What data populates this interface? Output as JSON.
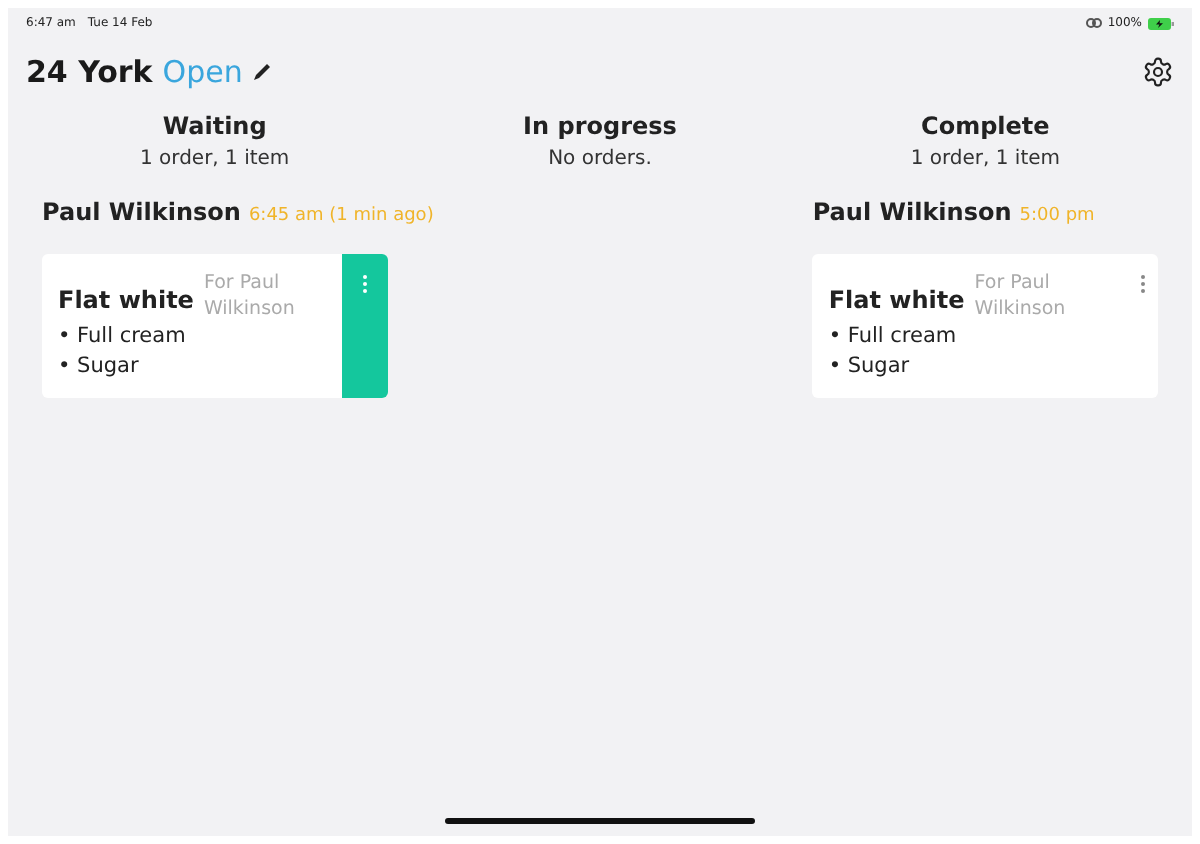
{
  "status_bar": {
    "time": "6:47 am",
    "date": "Tue 14 Feb",
    "battery": "100%"
  },
  "header": {
    "title": "24 York",
    "status": "Open"
  },
  "columns": [
    {
      "title": "Waiting",
      "summary": "1 order,  1 item",
      "orders": [
        {
          "customer": "Paul Wilkinson",
          "time": "6:45 am (1 min ago)",
          "items": [
            {
              "name": "Flat white",
              "for": "For Paul Wilkinson",
              "options": [
                "• Full cream",
                "• Sugar"
              ],
              "highlighted": true
            }
          ]
        }
      ]
    },
    {
      "title": "In progress",
      "summary": "No orders."
    },
    {
      "title": "Complete",
      "summary": "1 order,  1 item",
      "orders": [
        {
          "customer": "Paul Wilkinson",
          "time": "5:00 pm",
          "items": [
            {
              "name": "Flat white",
              "for": "For Paul Wilkinson",
              "options": [
                "• Full cream",
                "• Sugar"
              ],
              "highlighted": false
            }
          ]
        }
      ]
    }
  ]
}
